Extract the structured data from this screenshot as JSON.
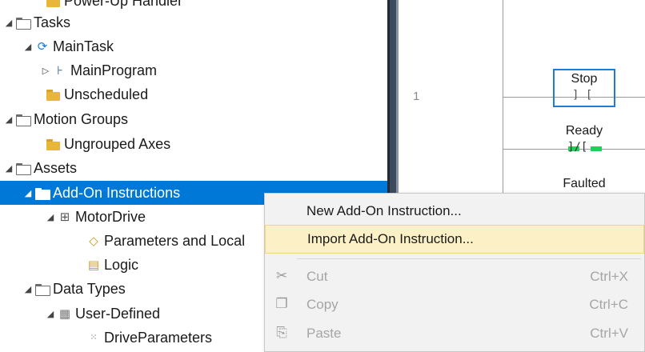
{
  "tree": {
    "items": [
      {
        "label": "Power-Up Handler"
      },
      {
        "label": "Tasks"
      },
      {
        "label": "MainTask"
      },
      {
        "label": "MainProgram"
      },
      {
        "label": "Unscheduled"
      },
      {
        "label": "Motion Groups"
      },
      {
        "label": "Ungrouped Axes"
      },
      {
        "label": "Assets"
      },
      {
        "label": "Add-On Instructions"
      },
      {
        "label": "MotorDrive"
      },
      {
        "label": "Parameters and Local"
      },
      {
        "label": "Logic"
      },
      {
        "label": "Data Types"
      },
      {
        "label": "User-Defined"
      },
      {
        "label": "DriveParameters"
      }
    ]
  },
  "ladder": {
    "rung_number": "1",
    "instructions": [
      {
        "name": "Stop"
      },
      {
        "name": "Ready"
      },
      {
        "name": "Faulted"
      }
    ]
  },
  "context_menu": {
    "items": [
      {
        "label": "New Add-On Instruction..."
      },
      {
        "label": "Import Add-On Instruction..."
      },
      {
        "label": "Cut",
        "shortcut": "Ctrl+X"
      },
      {
        "label": "Copy",
        "shortcut": "Ctrl+C"
      },
      {
        "label": "Paste",
        "shortcut": "Ctrl+V"
      }
    ]
  },
  "colors": {
    "selection": "#0078d7",
    "menu_hover": "#fcf1c6",
    "contact_energized": "#1fd15a",
    "focus_box": "#1e7bd8"
  }
}
